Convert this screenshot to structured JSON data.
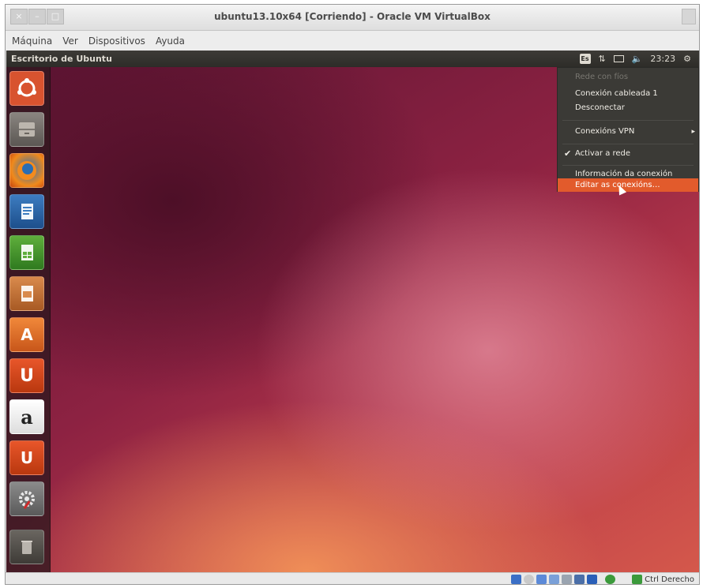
{
  "window": {
    "title": "ubuntu13.10x64 [Corriendo] - Oracle VM VirtualBox",
    "buttons": [
      "×",
      "–",
      "□"
    ]
  },
  "menubar": {
    "items": [
      "Máquina",
      "Ver",
      "Dispositivos",
      "Ayuda"
    ]
  },
  "ubuntu_panel": {
    "title": "Escritorio de Ubuntu",
    "keyboard_indicator": "Es",
    "clock": "23:23"
  },
  "launcher": {
    "items": [
      {
        "name": "ubuntu-dash",
        "label": ""
      },
      {
        "name": "files",
        "label": ""
      },
      {
        "name": "firefox",
        "label": ""
      },
      {
        "name": "libreoffice-writer",
        "label": ""
      },
      {
        "name": "libreoffice-calc",
        "label": ""
      },
      {
        "name": "libreoffice-impress",
        "label": ""
      },
      {
        "name": "software-center",
        "label": "A"
      },
      {
        "name": "ubuntu-one",
        "label": "U"
      },
      {
        "name": "amazon",
        "label": "a"
      },
      {
        "name": "ubuntu-one-music",
        "label": "U"
      },
      {
        "name": "system-settings",
        "label": ""
      },
      {
        "name": "trash",
        "label": ""
      }
    ]
  },
  "network_menu": {
    "header": "Rede con fíos",
    "items": [
      {
        "label": "Conexión cableada 1"
      },
      {
        "label": "Desconectar"
      },
      {
        "label": "Conexións VPN",
        "submenu": "▸"
      },
      {
        "label": "Activar a rede",
        "checked": "✔"
      },
      {
        "label": "Información da conexión"
      },
      {
        "label": "Editar as conexións…"
      }
    ]
  },
  "statusbar": {
    "host_key": "Ctrl Derecho"
  },
  "colors": {
    "menu_highlight": "#e25b2c",
    "panel": "#2d2c28"
  }
}
